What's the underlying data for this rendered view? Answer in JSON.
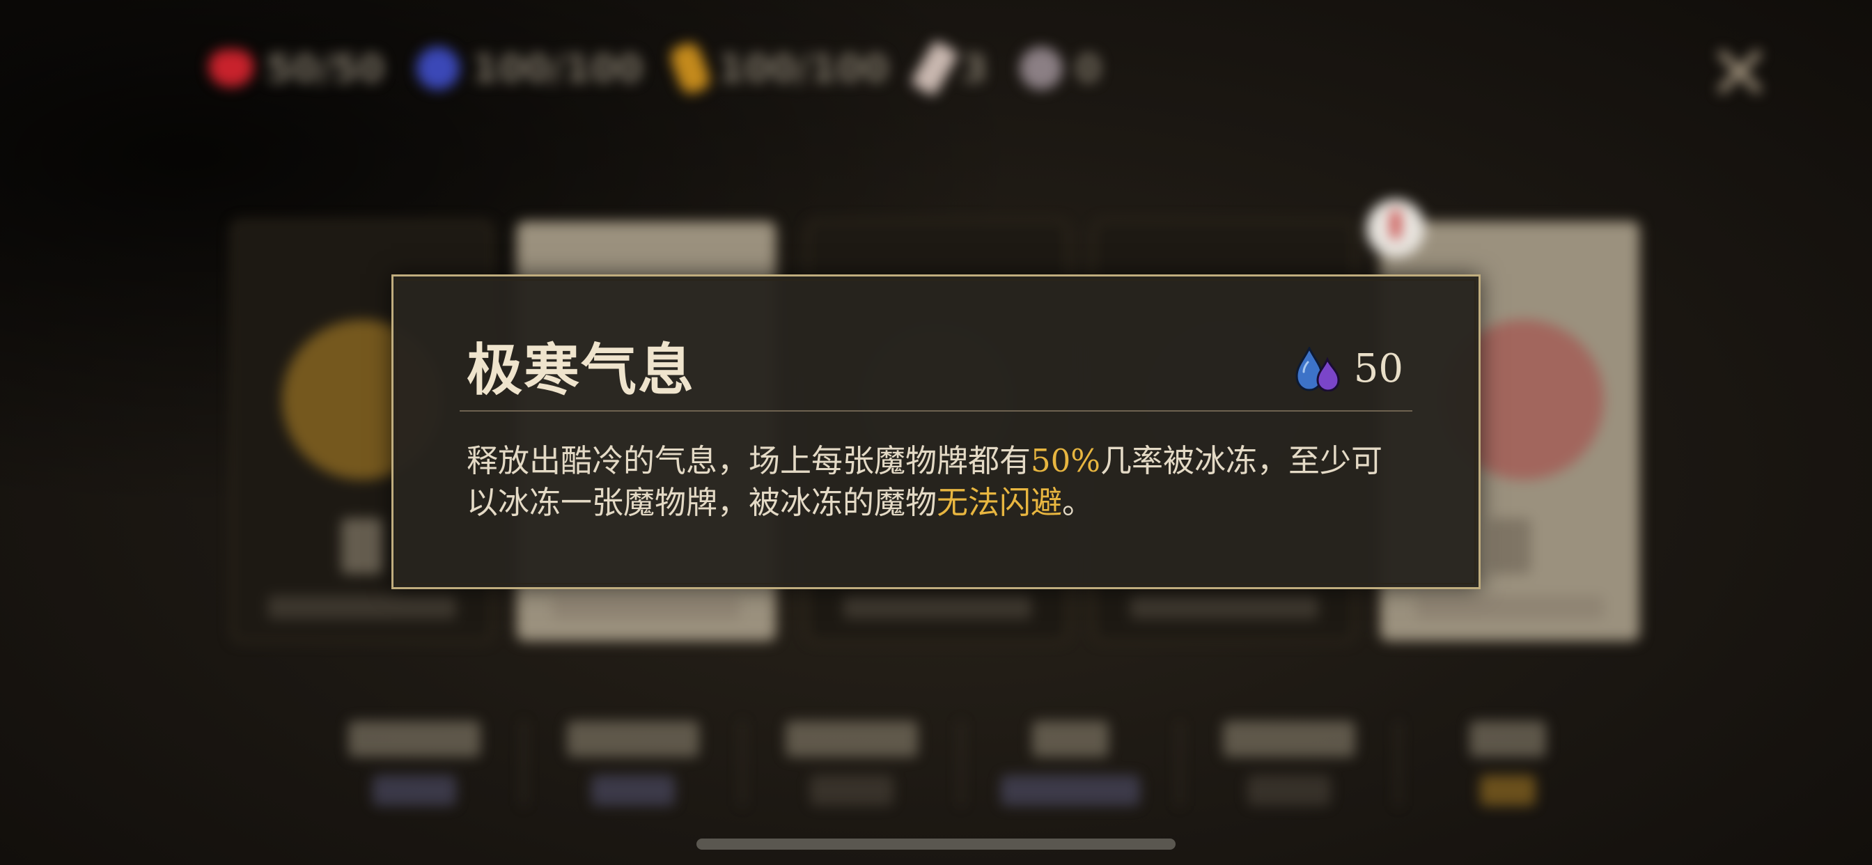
{
  "topbar": {
    "hp": "50/50",
    "mana": "100/100",
    "energy": "100/100",
    "potions": "3",
    "skulls": "0"
  },
  "tooltip": {
    "title": "极寒气息",
    "cost_value": "50",
    "cost_icon": "mana-drops-icon",
    "description": {
      "part1": "释放出酷冷的气息，场上每张魔物牌都有",
      "highlight1": "50%",
      "part2": "几率被冰冻，至少可以冰冻一张魔物牌，被冰冻的魔物",
      "highlight2": "无法闪避",
      "part3": "。"
    }
  },
  "colors": {
    "panel_border": "#c0ad7e",
    "title": "#efe4cd",
    "highlight": "#e8b640",
    "text": "#e4dac6"
  }
}
